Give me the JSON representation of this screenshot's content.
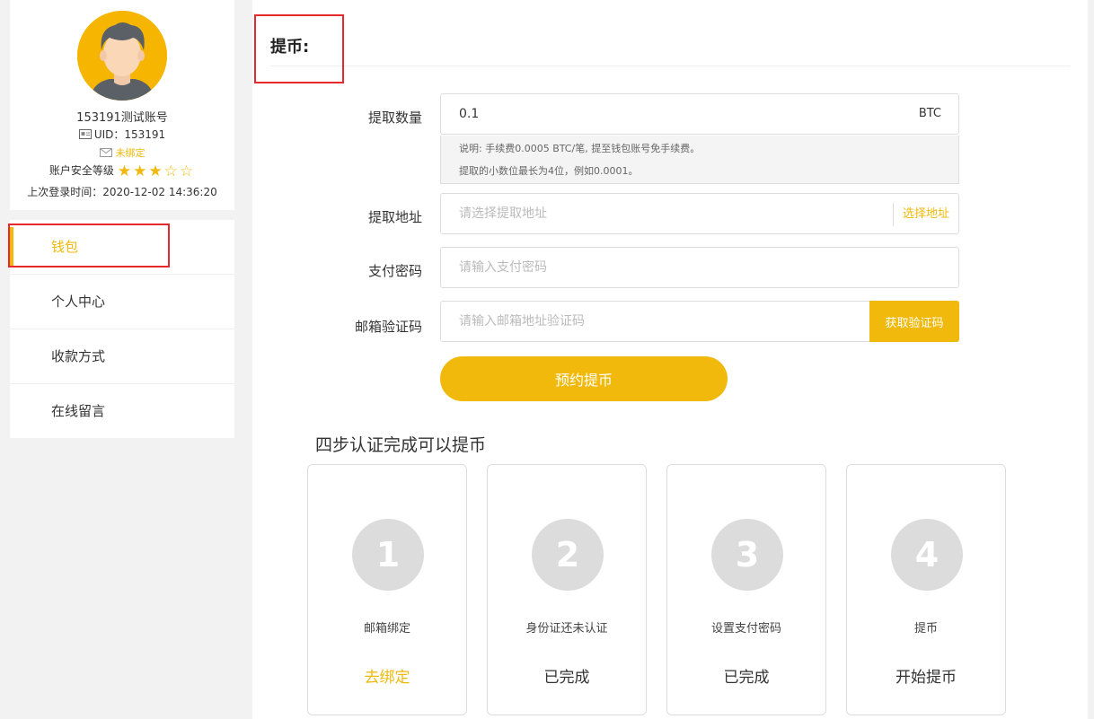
{
  "user": {
    "name": "153191测试账号",
    "uid": "UID：153191",
    "email_status": "未绑定",
    "security_label": "账户安全等级",
    "stars": "★★★☆☆",
    "last_login": "上次登录时间：2020-12-02 14:36:20"
  },
  "menu": [
    {
      "label": "钱包"
    },
    {
      "label": "个人中心"
    },
    {
      "label": "收款方式"
    },
    {
      "label": "在线留言"
    }
  ],
  "page": {
    "title": "提币:"
  },
  "form": {
    "amount": {
      "label": "提取数量",
      "value": "0.1",
      "unit": "BTC"
    },
    "notes": [
      "说明: 手续费0.0005 BTC/笔, 提至钱包账号免手续费。",
      "提取的小数位最长为4位，例如0.0001。"
    ],
    "address": {
      "label": "提取地址",
      "placeholder": "请选择提取地址",
      "action": "选择地址"
    },
    "password": {
      "label": "支付密码",
      "placeholder": "请输入支付密码"
    },
    "email_code": {
      "label": "邮箱验证码",
      "placeholder": "请输入邮箱地址验证码",
      "button": "获取验证码"
    },
    "submit": "预约提币"
  },
  "steps": {
    "title": "四步认证完成可以提币",
    "items": [
      {
        "num": "1",
        "name": "邮箱绑定",
        "status": "去绑定"
      },
      {
        "num": "2",
        "name": "身份证还未认证",
        "status": "已完成"
      },
      {
        "num": "3",
        "name": "设置支付密码",
        "status": "已完成"
      },
      {
        "num": "4",
        "name": "提币",
        "status": "开始提币"
      }
    ]
  },
  "colors": {
    "accent": "#f0b90b",
    "highlight": "#e8282b"
  }
}
